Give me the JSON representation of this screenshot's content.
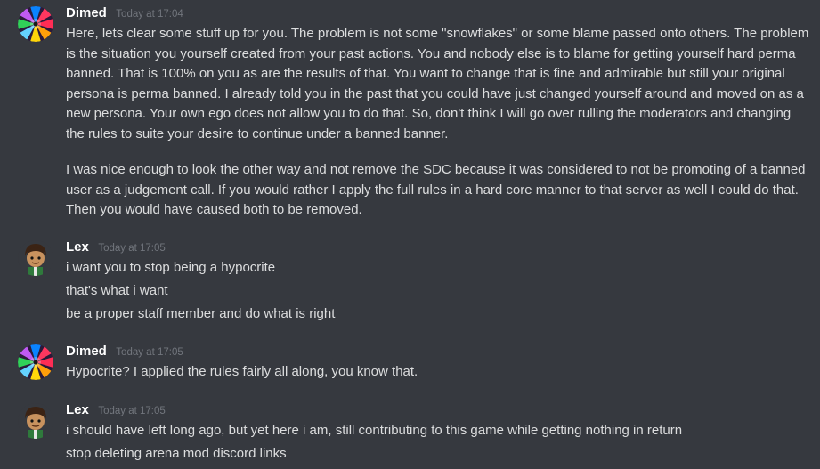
{
  "colors": {
    "background": "#36393f",
    "text": "#dcddde",
    "username": "#ffffff",
    "timestamp": "#72767d"
  },
  "messages": [
    {
      "author": "Dimed",
      "avatar_icon": "rainbow-spiral-avatar",
      "timestamp": "Today at 17:04",
      "lines": [
        "Here, lets clear some stuff up for you. The problem is not some \"snowflakes\" or some blame passed onto others. The problem is the situation you yourself created from your past actions. You and nobody else is to blame for getting yourself hard perma banned. That is 100% on you as are the results of that. You want to change that is fine and admirable but still your original persona is perma banned. I already told you in the past that you could have just changed yourself around and moved on as a new persona. Your own ego does not allow you to do that. So, don't think I will go over rulling the moderators and changing the rules to suite your desire to continue under a banned banner.",
        "I was nice enough to look the other way and not remove the SDC because it was considered to not be promoting of a banned user as a judgement call. If you would rather I apply the full rules in a hard core manner to that server as well I could do that. Then you would have caused both to be removed."
      ]
    },
    {
      "author": "Lex",
      "avatar_icon": "cartoon-character-avatar",
      "timestamp": "Today at 17:05",
      "lines": [
        "i want you to stop being a hypocrite",
        "that's what i want",
        "be a proper staff member and do what is right"
      ]
    },
    {
      "author": "Dimed",
      "avatar_icon": "rainbow-spiral-avatar",
      "timestamp": "Today at 17:05",
      "lines": [
        "Hypocrite? I applied the rules fairly all along, you know that."
      ]
    },
    {
      "author": "Lex",
      "avatar_icon": "cartoon-character-avatar",
      "timestamp": "Today at 17:05",
      "lines": [
        "i should have left long ago, but yet here i am, still contributing to this game while getting nothing in return",
        "stop deleting arena mod discord links"
      ]
    }
  ]
}
